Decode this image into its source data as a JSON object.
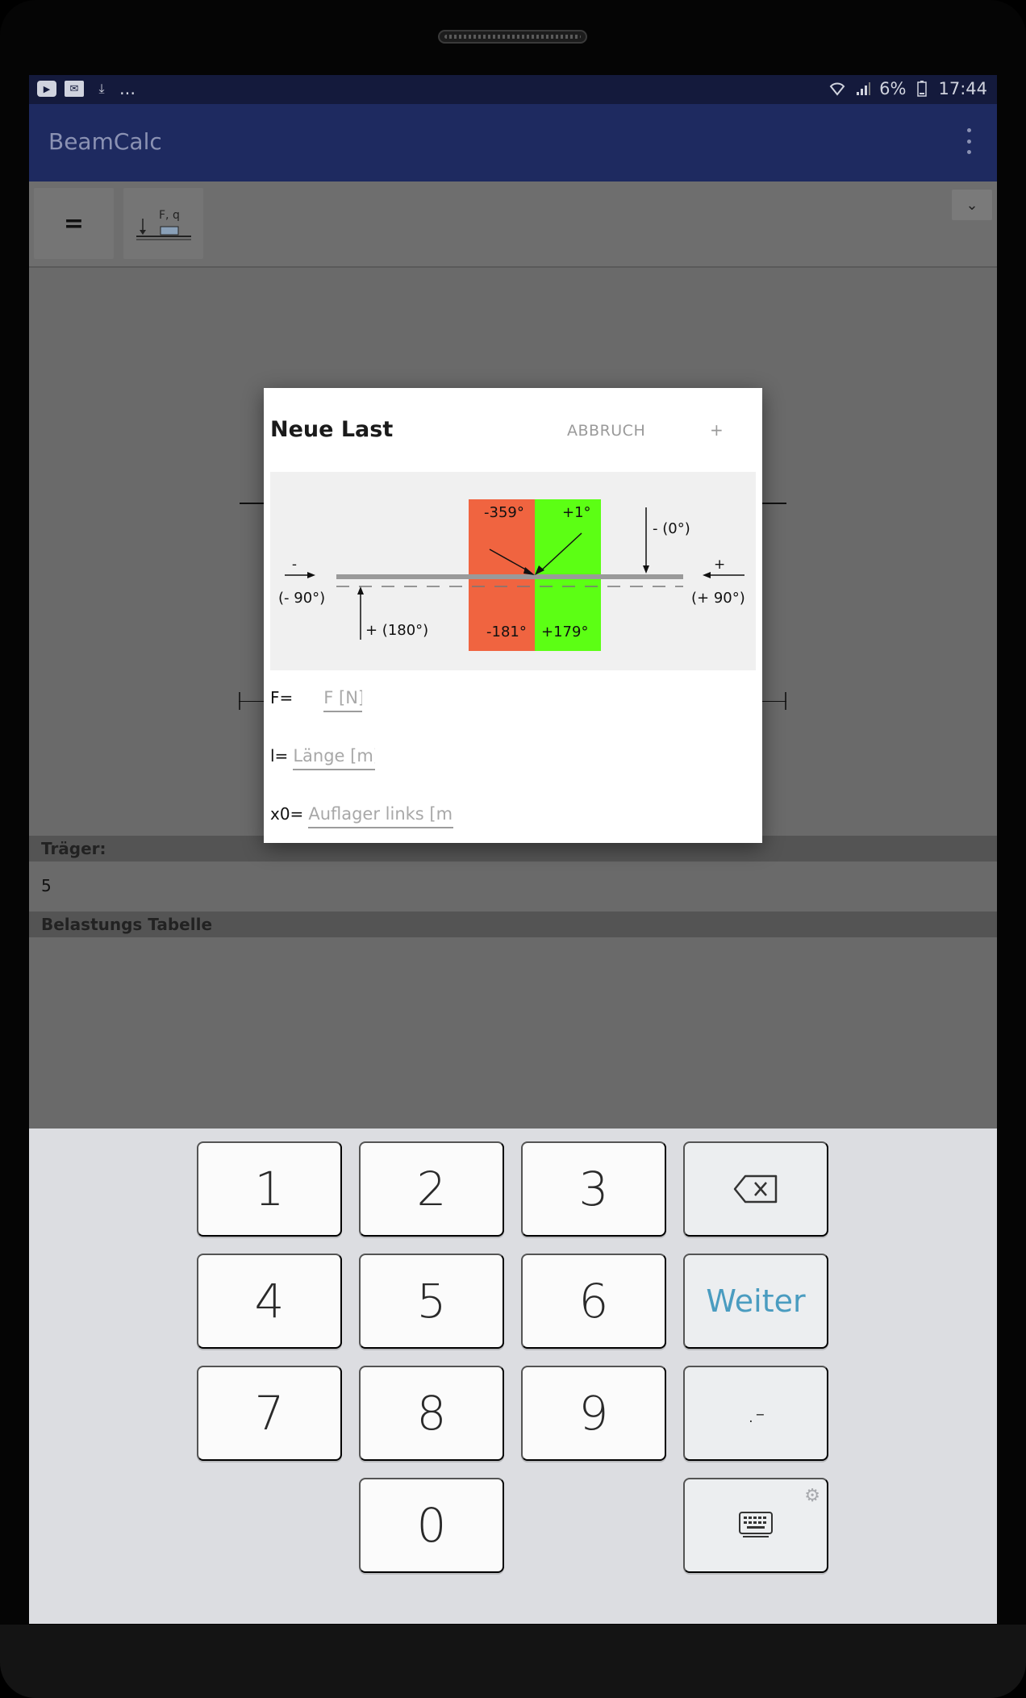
{
  "status_bar": {
    "left_icons": [
      "youtube-icon",
      "mail-icon",
      "download-icon"
    ],
    "more": "...",
    "battery": "6%",
    "time": "17:44"
  },
  "app_bar": {
    "title": "BeamCalc"
  },
  "toolbar": {
    "equals_label": "=",
    "load_label": "F, q"
  },
  "sections": {
    "beam_header": "Träger:",
    "beam_value": "5",
    "load_table_header": "Belastungs Tabelle"
  },
  "dialog": {
    "title": "Neue Last",
    "cancel": "ABBRUCH",
    "add": "+",
    "diagram": {
      "minus_label": "-",
      "minus_angle": "(- 90°)",
      "plus_label": "+",
      "plus_angle": "(+ 90°)",
      "top_angle": "- (0°)",
      "bottom_angle": "+ (180°)",
      "q_top_left": "-359°",
      "q_top_right": "+1°",
      "q_bottom_left": "-181°",
      "q_bottom_right": "+179°",
      "red": "#f06440",
      "green": "#5cff14"
    },
    "fields": {
      "force_label": "F=",
      "force_placeholder": "F [N]",
      "length_label": "l=",
      "length_placeholder": "Länge [m]",
      "x0_label": "x0=",
      "x0_placeholder": "Auflager links [m]"
    }
  },
  "keyboard": {
    "digits": [
      "1",
      "2",
      "3",
      "4",
      "5",
      "6",
      "7",
      "8",
      "9",
      "0"
    ],
    "next": "Weiter",
    "symbols": ".-"
  }
}
